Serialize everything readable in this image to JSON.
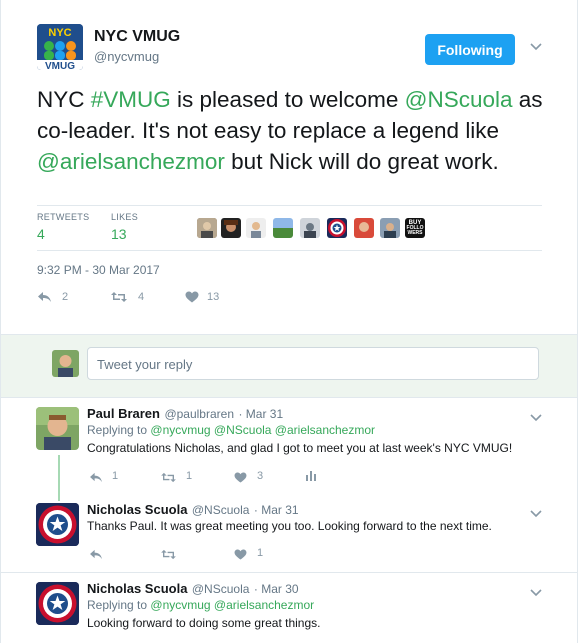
{
  "tweet": {
    "author_name": "NYC VMUG",
    "author_handle": "@nycvmug",
    "avatar_text_top": "NYC",
    "avatar_text_bottom": "VMUG",
    "follow_label": "Following",
    "text_parts": [
      "NYC ",
      "#VMUG",
      " is pleased to welcome ",
      "@NScuola",
      " as co-leader. It's not easy to replace a legend like ",
      "@arielsanchezmor",
      " but Nick will do great work."
    ],
    "retweets_label": "RETWEETS",
    "retweets_count": "4",
    "likes_label": "LIKES",
    "likes_count": "13",
    "timestamp": "9:32 PM - 30 Mar 2017",
    "replies": "2",
    "retweets": "4",
    "likes": "13",
    "buy_badge": [
      "BUY",
      "FOLLO",
      "WERS"
    ]
  },
  "reply_box": {
    "placeholder": "Tweet your reply"
  },
  "replies": [
    {
      "name": "Paul Braren",
      "handle": "@paulbraren",
      "date": "· Mar 31",
      "replying_prefix": "Replying to",
      "replying_to": "@nycvmug @NScuola @arielsanchezmor",
      "text": "Congratulations Nicholas, and glad I got to meet you at last week's NYC VMUG!",
      "reply_count": "1",
      "retweet_count": "1",
      "like_count": "3"
    },
    {
      "name": "Nicholas Scuola",
      "handle": "@NScuola",
      "date": "· Mar 31",
      "text": "Thanks Paul. It was great meeting you too. Looking forward to the next time.",
      "like_count": "1"
    },
    {
      "name": "Nicholas Scuola",
      "handle": "@NScuola",
      "date": "· Mar 30",
      "replying_prefix": "Replying to",
      "replying_to": "@nycvmug @arielsanchezmor",
      "text": "Looking forward to doing some great things."
    }
  ]
}
